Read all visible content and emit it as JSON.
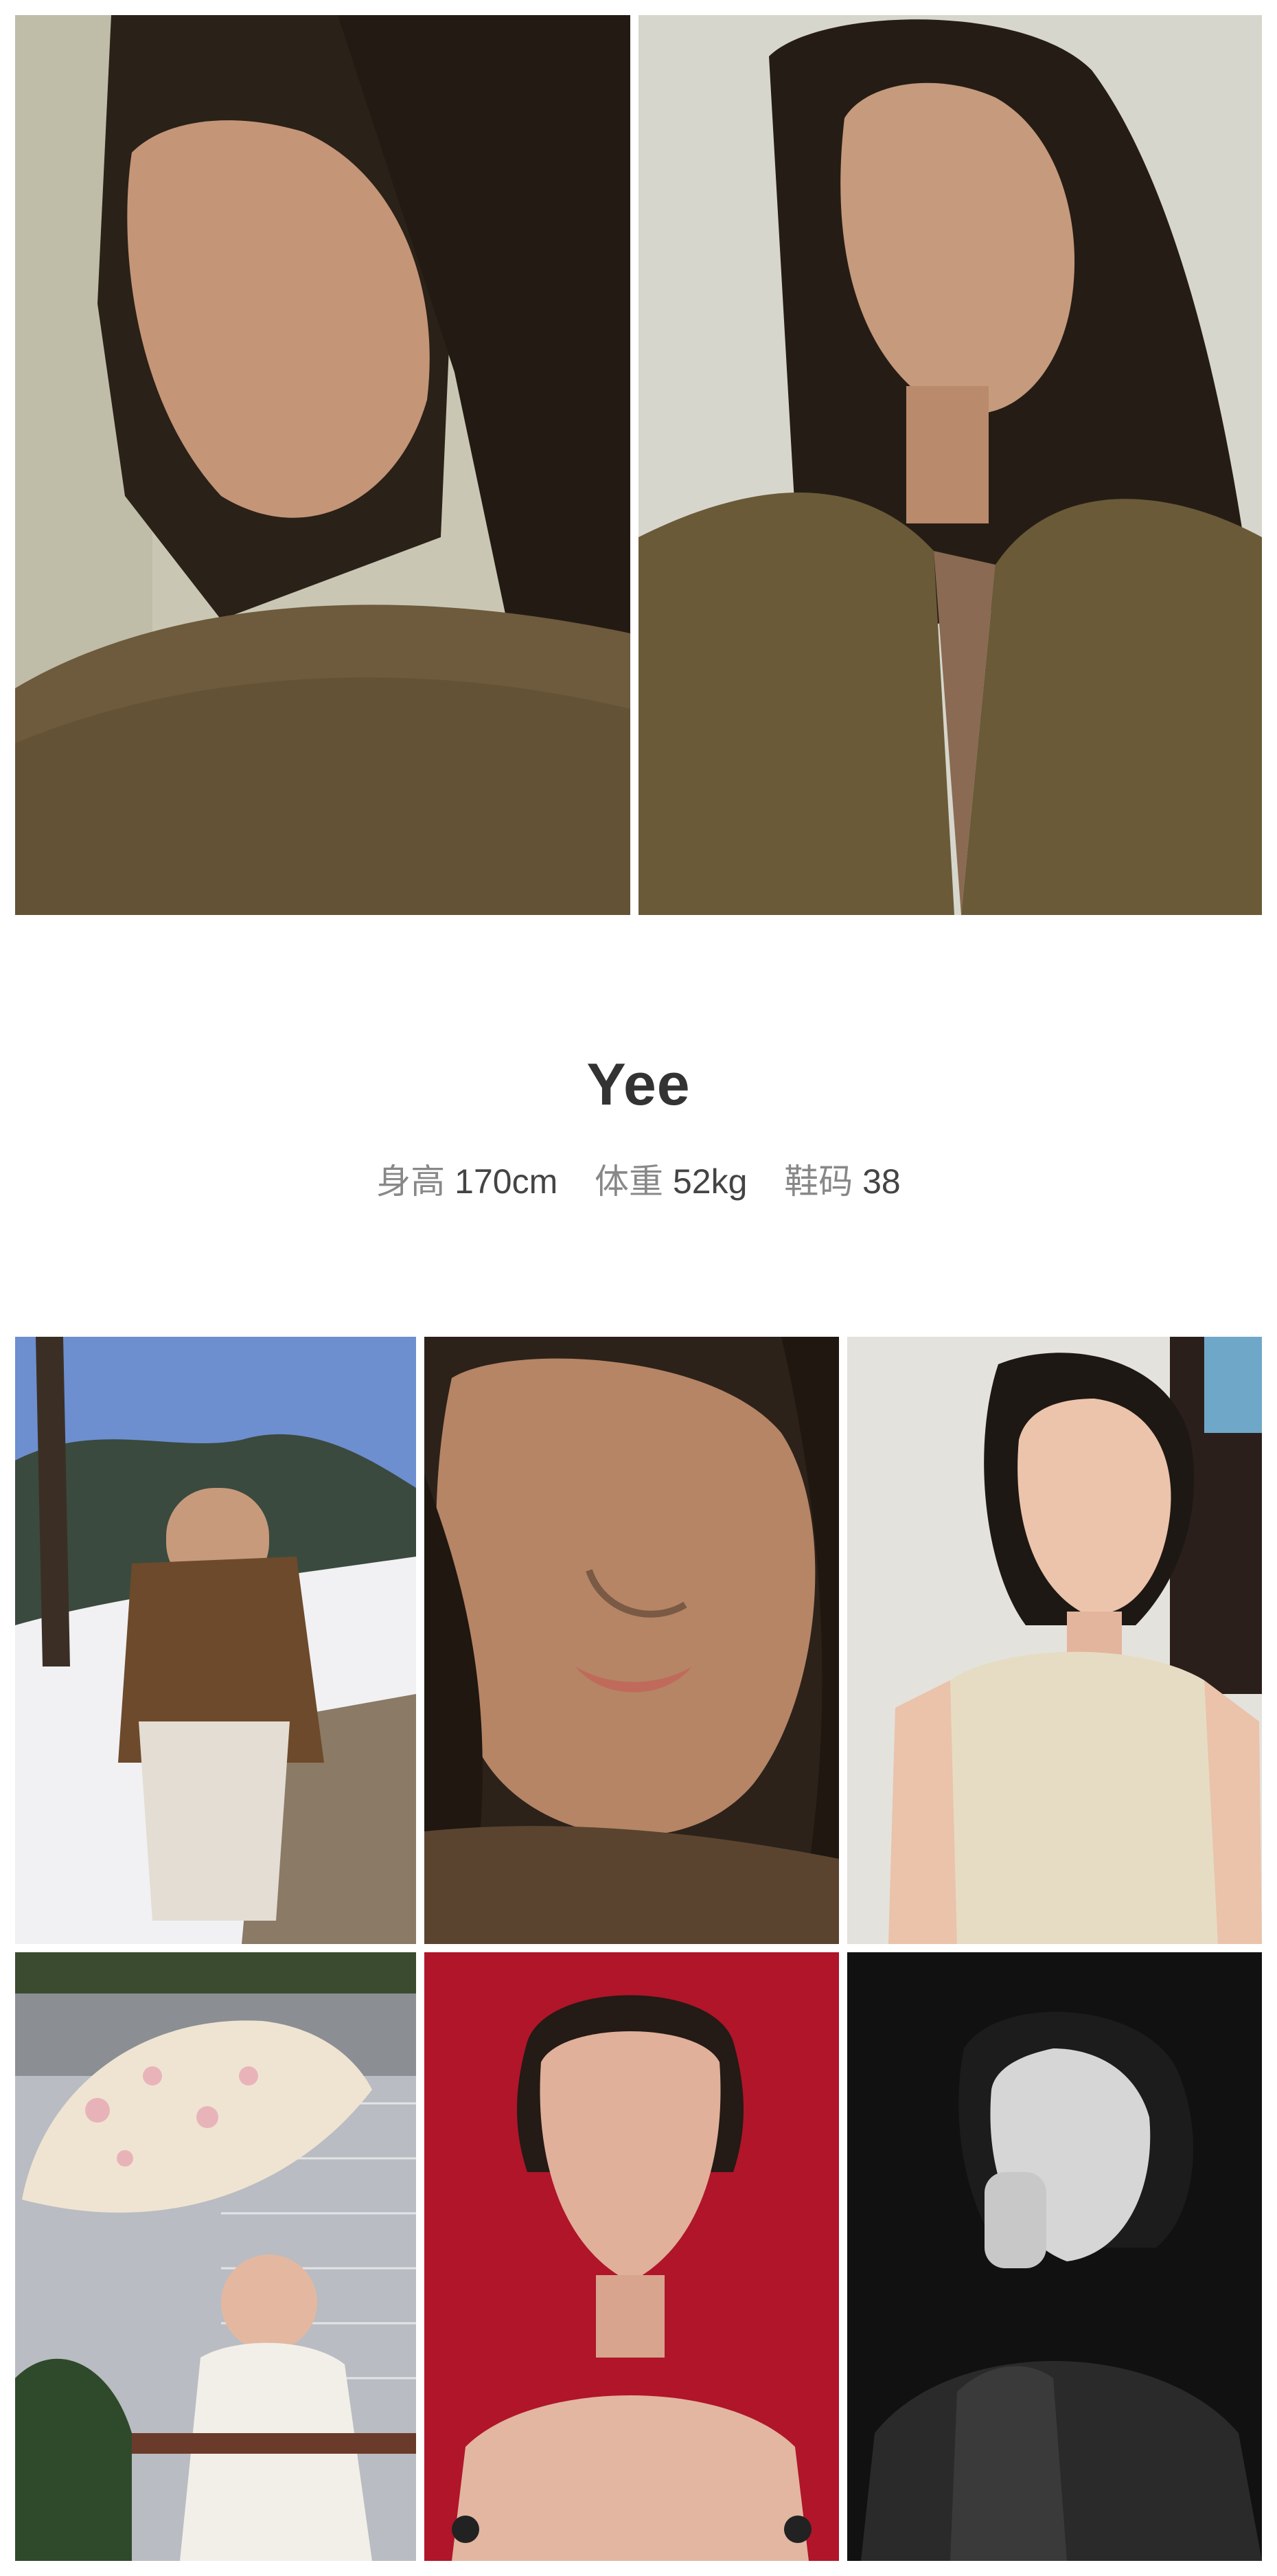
{
  "profile": {
    "name": "Yee",
    "height_label": "身高",
    "height_value": "170cm",
    "weight_label": "体重",
    "weight_value": "52kg",
    "shoe_label": "鞋码",
    "shoe_value": "38"
  },
  "photos": {
    "top": [
      {
        "icon": "portrait-profile-photo",
        "bg": "#c9c7b4",
        "tone": "#6e5a3c"
      },
      {
        "icon": "portrait-front-photo",
        "bg": "#d7d6cc",
        "tone": "#6a5a38"
      }
    ],
    "grid": [
      {
        "icon": "snow-scene-photo",
        "bg": "#6d8fd0",
        "tone": "#f1f1f4"
      },
      {
        "icon": "closeup-face-photo",
        "bg": "#4d3b2c",
        "tone": "#b58566"
      },
      {
        "icon": "sleeveless-top-photo",
        "bg": "#e4e2dc",
        "tone": "#e6dcc4"
      },
      {
        "icon": "umbrella-photo",
        "bg": "#b9bcc2",
        "tone": "#f2efe9"
      },
      {
        "icon": "red-background-photo",
        "bg": "#b0152a",
        "tone": "#e0b09a"
      },
      {
        "icon": "black-white-photo",
        "bg": "#111111",
        "tone": "#d6d6d6"
      }
    ]
  }
}
